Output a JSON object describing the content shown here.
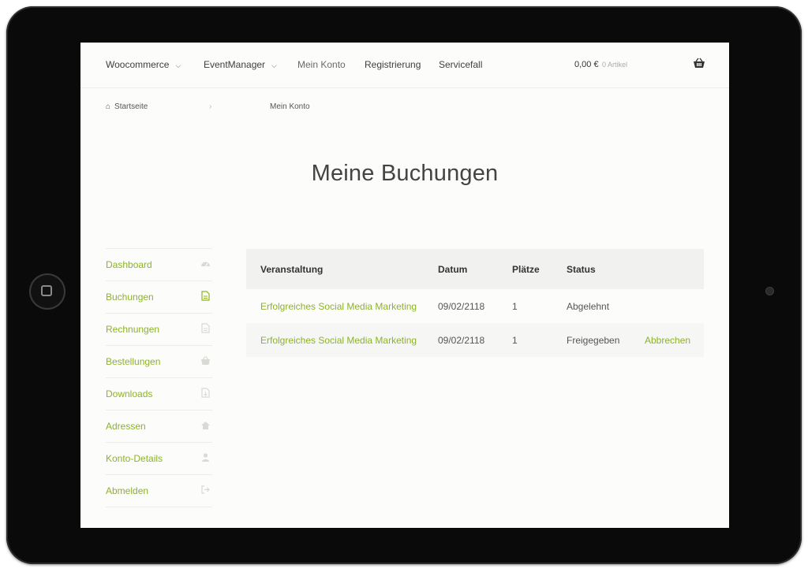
{
  "nav": {
    "items": [
      {
        "label": "Woocommerce"
      },
      {
        "label": "EventManager"
      },
      {
        "label": "Mein Konto"
      },
      {
        "label": "Registrierung"
      },
      {
        "label": "Servicefall"
      }
    ],
    "cart_amount": "0,00 €",
    "cart_count": "0 Artikel"
  },
  "breadcrumb": {
    "home": "Startseite",
    "separator": "›",
    "current": "Mein Konto"
  },
  "page_title": "Meine Buchungen",
  "sidebar": {
    "items": [
      {
        "label": "Dashboard",
        "icon": "dashboard-icon"
      },
      {
        "label": "Buchungen",
        "icon": "document-icon"
      },
      {
        "label": "Rechnungen",
        "icon": "document-icon"
      },
      {
        "label": "Bestellungen",
        "icon": "basket-icon"
      },
      {
        "label": "Downloads",
        "icon": "download-file-icon"
      },
      {
        "label": "Adressen",
        "icon": "home-icon"
      },
      {
        "label": "Konto-Details",
        "icon": "user-icon"
      },
      {
        "label": "Abmelden",
        "icon": "sign-out-icon"
      }
    ]
  },
  "bookings": {
    "headers": {
      "event": "Veranstaltung",
      "date": "Datum",
      "seats": "Plätze",
      "status": "Status"
    },
    "rows": [
      {
        "event": "Erfolgreiches Social Media Marketing",
        "date": "09/02/2118",
        "seats": "1",
        "status": "Abgelehnt",
        "action": ""
      },
      {
        "event": "Erfolgreiches Social Media Marketing",
        "date": "09/02/2118",
        "seats": "1",
        "status": "Freigegeben",
        "action": "Abbrechen"
      }
    ]
  },
  "colors": {
    "accent": "#8db22b",
    "text": "#444444",
    "device_frame": "#0a0a0a"
  }
}
